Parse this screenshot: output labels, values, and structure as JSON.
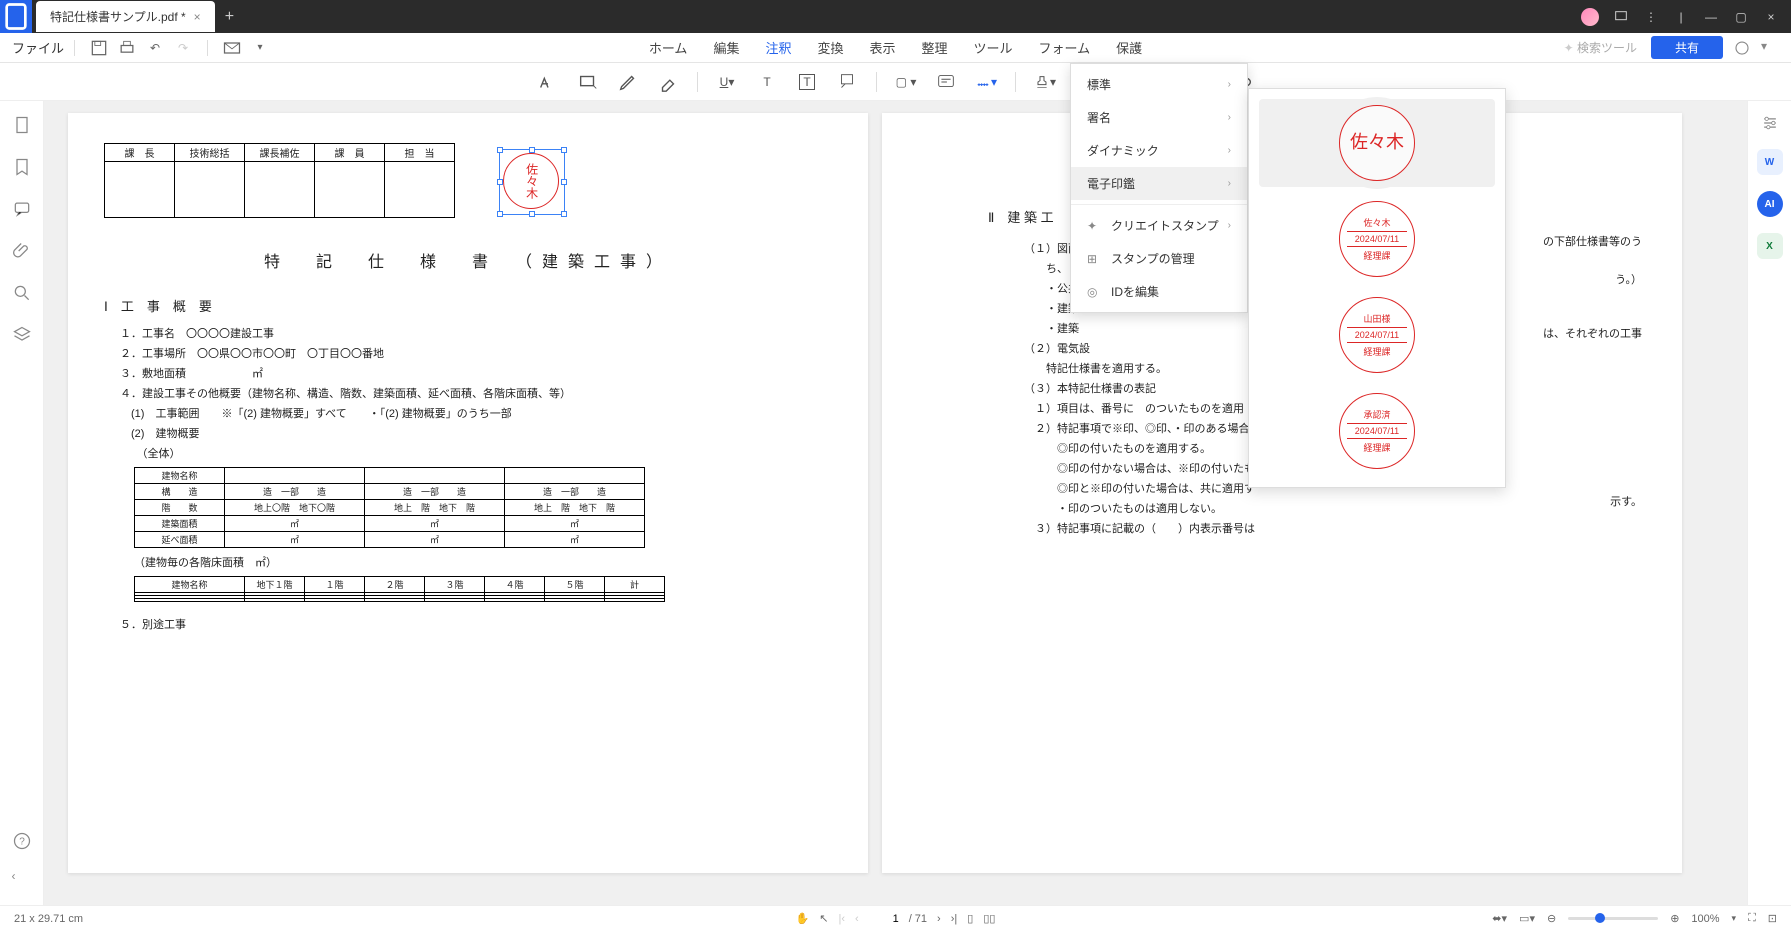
{
  "titlebar": {
    "filename": "特記仕様書サンプル.pdf *"
  },
  "toolbar": {
    "file": "ファイル"
  },
  "menus": {
    "home": "ホーム",
    "edit": "編集",
    "annotate": "注釈",
    "convert": "変換",
    "view": "表示",
    "organize": "整理",
    "tools": "ツール",
    "form": "フォーム",
    "protect": "保護",
    "search": "検索ツール",
    "share": "共有"
  },
  "stamp_menu": {
    "standard": "標準",
    "signature": "署名",
    "dynamic": "ダイナミック",
    "eseal": "電子印鑑",
    "create": "クリエイトスタンプ",
    "manage": "スタンプの管理",
    "edit_id": "IDを編集"
  },
  "stamps": [
    {
      "type": "name",
      "text": "佐々木"
    },
    {
      "type": "dated",
      "name": "佐々木",
      "date": "2024/07/11",
      "dept": "経理課"
    },
    {
      "type": "dated",
      "name": "山田様",
      "date": "2024/07/11",
      "dept": "経理課"
    },
    {
      "type": "dated",
      "name": "承認済",
      "date": "2024/07/11",
      "dept": "経理課"
    },
    {
      "type": "partial",
      "text": "佐"
    }
  ],
  "page1": {
    "sig_headers": [
      "課　長",
      "技術総括",
      "課長補佐",
      "課　員",
      "担　当"
    ],
    "stamp_text": "佐々木",
    "title": "特　記　仕　様　書　（建築工事）",
    "section1": "Ⅰ　工　事　概　要",
    "lines": [
      "１．工事名　〇〇〇〇建設工事",
      "２．工事場所　〇〇県〇〇市〇〇町　〇丁目〇〇番地",
      "３．敷地面積　　　　　　㎡",
      "４．建設工事その他概要（建物名称、構造、階数、建築面積、延べ面積、各階床面積、等）",
      "　(1)　工事範囲　　※「(2) 建物概要」すべて　　・「(2) 建物概要」のうち一部",
      "　(2)　建物概要",
      "　　（全体）"
    ],
    "tbl1_rows": [
      "建物名称",
      "構　　造",
      "階　　数",
      "建築面積",
      "延べ面積"
    ],
    "tbl1_r2": [
      "造　一部　　造",
      "造　一部　　造",
      "造　一部　　造"
    ],
    "tbl1_r3": [
      "地上〇階　地下〇階",
      "地上　階　地下　階",
      "地上　階　地下　階"
    ],
    "tbl1_m": "㎡",
    "tbl2_note": "（建物毎の各階床面積　㎡）",
    "tbl2_headers": [
      "建物名称",
      "地下１階",
      "１階",
      "２階",
      "３階",
      "４階",
      "５階",
      "計"
    ],
    "line5": "５．別途工事"
  },
  "page2": {
    "section2": "Ⅱ　建 築 工",
    "lines": [
      "（１）図面及",
      "　　ち、",
      "　　・公共",
      "　　・建築",
      "　　・建築",
      "（２）電気設",
      "　　特記仕様書を適用する。",
      "（３）本特記仕様書の表記",
      "　１）項目は、番号に　のついたものを適用",
      "　２）特記事項で※印、◎印、・印のある場合",
      "　　　◎印の付いたものを適用する。",
      "　　　◎印の付かない場合は、※印の付いたもの",
      "　　　◎印と※印の付いた場合は、共に適用す",
      "　　　・印のついたものは適用しない。",
      "　３）特記事項に記載の（　　）内表示番号は"
    ],
    "right_frag1": "の下部仕様書等のう",
    "right_frag2": "う。）",
    "right_frag3": "は、それぞれの工事",
    "right_frag4": "示す。"
  },
  "statusbar": {
    "dims": "21 x 29.71 cm",
    "page_current": "1",
    "page_total": "/ 71",
    "zoom": "100%"
  }
}
